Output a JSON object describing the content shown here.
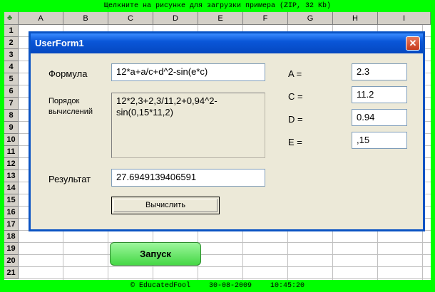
{
  "top_banner": "Щелкните на рисунке для загрузки примера   (ZIP, 32 Kb)",
  "footer": {
    "author": "© EducatedFool",
    "date": "30-08-2009",
    "time": "10:45:20"
  },
  "sheet": {
    "columns": [
      "A",
      "B",
      "C",
      "D",
      "E",
      "F",
      "G",
      "H",
      "I"
    ],
    "rows": [
      "1",
      "2",
      "3",
      "4",
      "5",
      "6",
      "7",
      "8",
      "9",
      "10",
      "11",
      "12",
      "13",
      "14",
      "15",
      "16",
      "17",
      "18",
      "19",
      "20",
      "21"
    ]
  },
  "run_button": "Запуск",
  "dialog": {
    "title": "UserForm1",
    "close_glyph": "✕",
    "formula_label": "Формула",
    "formula_value": "12*a+a/c+d^2-sin(e*c)",
    "order_label": "Порядок вычислений",
    "order_value": "12*2,3+2,3/11,2+0,94^2-sin(0,15*11,2)",
    "result_label": "Результат",
    "result_value": "27.6949139406591",
    "calc_button": "Вычислить",
    "vars": [
      {
        "label": "A =",
        "value": "2.3"
      },
      {
        "label": "C =",
        "value": "11.2"
      },
      {
        "label": "D =",
        "value": "0.94"
      },
      {
        "label": "E =",
        "value": ",15"
      }
    ]
  }
}
